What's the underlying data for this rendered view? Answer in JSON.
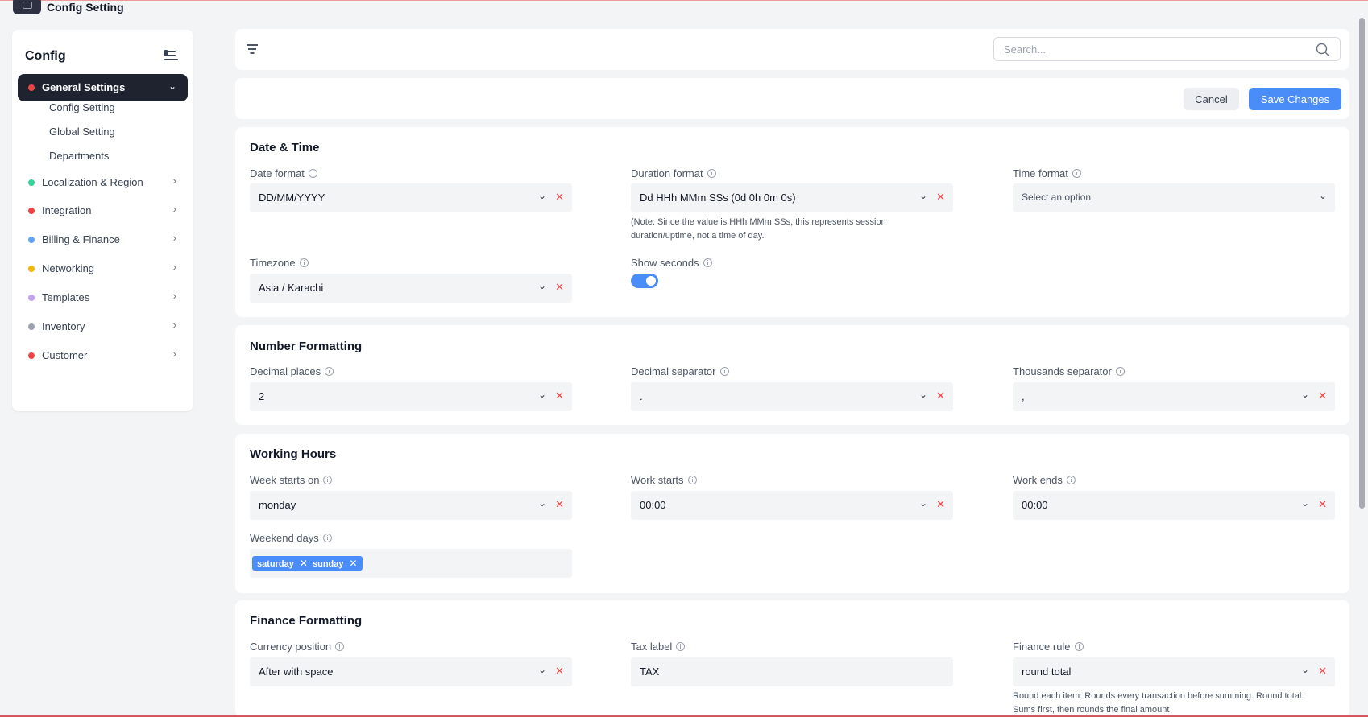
{
  "app": {
    "title": "Config Setting"
  },
  "sidebar": {
    "title": "Config",
    "active": {
      "label": "General Settings",
      "dot_color": "#ef4444"
    },
    "subitems": [
      "Config Setting",
      "Global Setting",
      "Departments"
    ],
    "items": [
      {
        "label": "Localization & Region",
        "dot_color": "#34d399"
      },
      {
        "label": "Integration",
        "dot_color": "#ef4444"
      },
      {
        "label": "Billing & Finance",
        "dot_color": "#60a5fa"
      },
      {
        "label": "Networking",
        "dot_color": "#f5b50b"
      },
      {
        "label": "Templates",
        "dot_color": "#c4a1f0"
      },
      {
        "label": "Inventory",
        "dot_color": "#9ca3af"
      },
      {
        "label": "Customer",
        "dot_color": "#ef4444"
      }
    ]
  },
  "toolbar": {
    "search_placeholder": "Search..."
  },
  "actions": {
    "cancel_label": "Cancel",
    "save_label": "Save Changes"
  },
  "date_time": {
    "title": "Date & Time",
    "date_format": {
      "label": "Date format",
      "value": "DD/MM/YYYY"
    },
    "duration_format": {
      "label": "Duration format",
      "value": "Dd HHh MMm SSs (0d 0h 0m 0s)",
      "note_line1": "(Note: Since the value is HHh MMm SSs, this represents session",
      "note_line2": "duration/uptime, not a time of day."
    },
    "time_format": {
      "label": "Time format",
      "placeholder": "Select an option"
    },
    "timezone": {
      "label": "Timezone",
      "value": "Asia / Karachi"
    },
    "show_seconds": {
      "label": "Show seconds",
      "enabled": true
    }
  },
  "number_formatting": {
    "title": "Number Formatting",
    "decimal_places": {
      "label": "Decimal places",
      "value": "2"
    },
    "decimal_separator": {
      "label": "Decimal separator",
      "value": "."
    },
    "thousands_separator": {
      "label": "Thousands separator",
      "value": ","
    }
  },
  "working_hours": {
    "title": "Working Hours",
    "week_starts_on": {
      "label": "Week starts on",
      "value": "monday"
    },
    "work_starts": {
      "label": "Work starts",
      "value": "00:00"
    },
    "work_ends": {
      "label": "Work ends",
      "value": "00:00"
    },
    "weekend_days": {
      "label": "Weekend days",
      "tags": [
        "saturday",
        "sunday"
      ]
    }
  },
  "finance_formatting": {
    "title": "Finance Formatting",
    "currency_position": {
      "label": "Currency position",
      "value": "After with space"
    },
    "tax_label": {
      "label": "Tax label",
      "value": "TAX"
    },
    "finance_rule": {
      "label": "Finance rule",
      "value": "round total",
      "note_line1": "Round each item: Rounds every transaction before summing. Round total:",
      "note_line2": "Sums first, then rounds the final amount"
    }
  },
  "colors": {
    "accent": "#4b8df8",
    "sidebar_active_bg": "#1f2330",
    "clear": "#ef4444"
  }
}
